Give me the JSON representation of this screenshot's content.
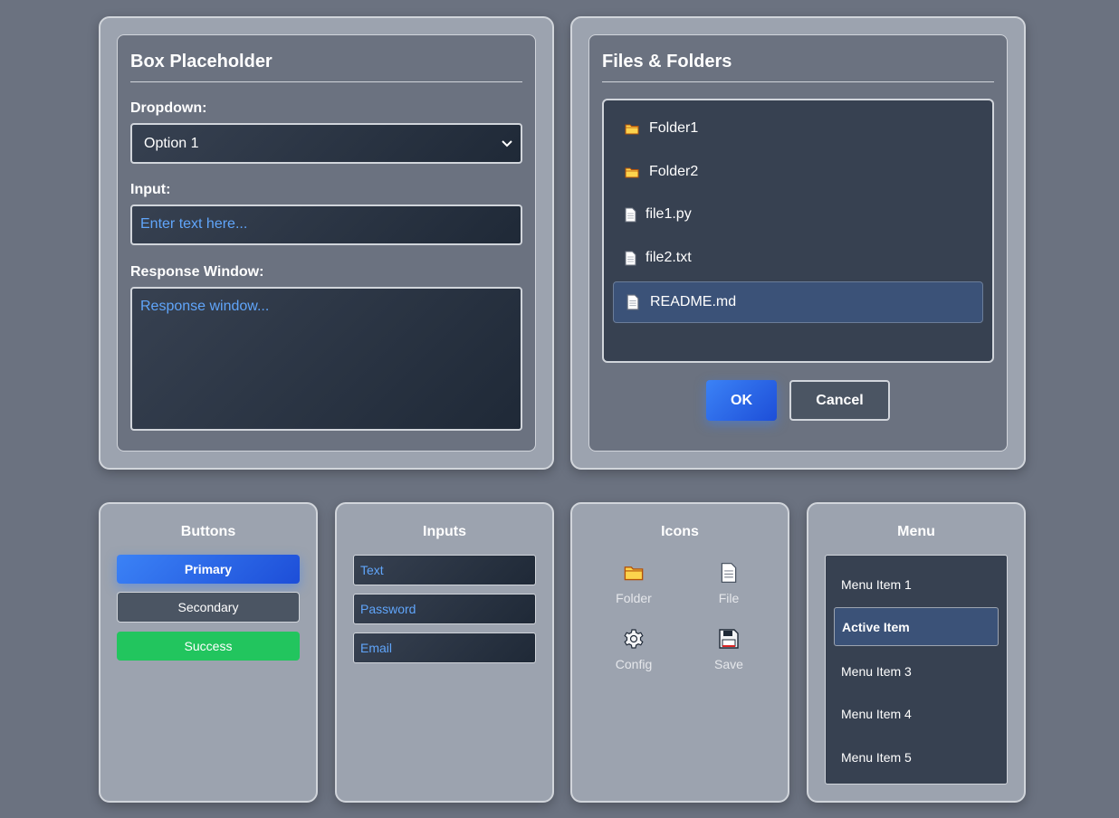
{
  "box_panel": {
    "title": "Box Placeholder",
    "dropdown_label": "Dropdown:",
    "dropdown_value": "Option 1",
    "input_label": "Input:",
    "input_placeholder": "Enter text here...",
    "response_label": "Response Window:",
    "response_placeholder": "Response window..."
  },
  "files_panel": {
    "title": "Files & Folders",
    "items": [
      {
        "name": "Folder1",
        "icon": "folder-icon"
      },
      {
        "name": "Folder2",
        "icon": "folder-icon"
      },
      {
        "name": "file1.py",
        "icon": "file-icon"
      },
      {
        "name": "file2.txt",
        "icon": "file-icon"
      },
      {
        "name": "README.md",
        "icon": "file-icon",
        "selected": true
      }
    ],
    "ok_label": "OK",
    "cancel_label": "Cancel"
  },
  "buttons_panel": {
    "title": "Buttons",
    "primary": "Primary",
    "secondary": "Secondary",
    "success": "Success"
  },
  "inputs_panel": {
    "title": "Inputs",
    "text_placeholder": "Text",
    "password_placeholder": "Password",
    "email_placeholder": "Email"
  },
  "icons_panel": {
    "title": "Icons",
    "items": [
      {
        "label": "Folder",
        "icon": "folder-icon"
      },
      {
        "label": "File",
        "icon": "file-icon"
      },
      {
        "label": "Config",
        "icon": "gear-icon"
      },
      {
        "label": "Save",
        "icon": "floppy-disk-icon"
      }
    ]
  },
  "menu_panel": {
    "title": "Menu",
    "items": [
      "Menu Item 1",
      "Active Item",
      "Menu Item 3",
      "Menu Item 4",
      "Menu Item 5"
    ],
    "active_item": "Active Item"
  },
  "colors": {
    "background": "#6b7280",
    "panel": "#9ca3af",
    "accent_blue": "#3b82f6",
    "success_green": "#22c55e",
    "placeholder_blue": "#60a5fa",
    "selected_item": "#3b5278"
  }
}
